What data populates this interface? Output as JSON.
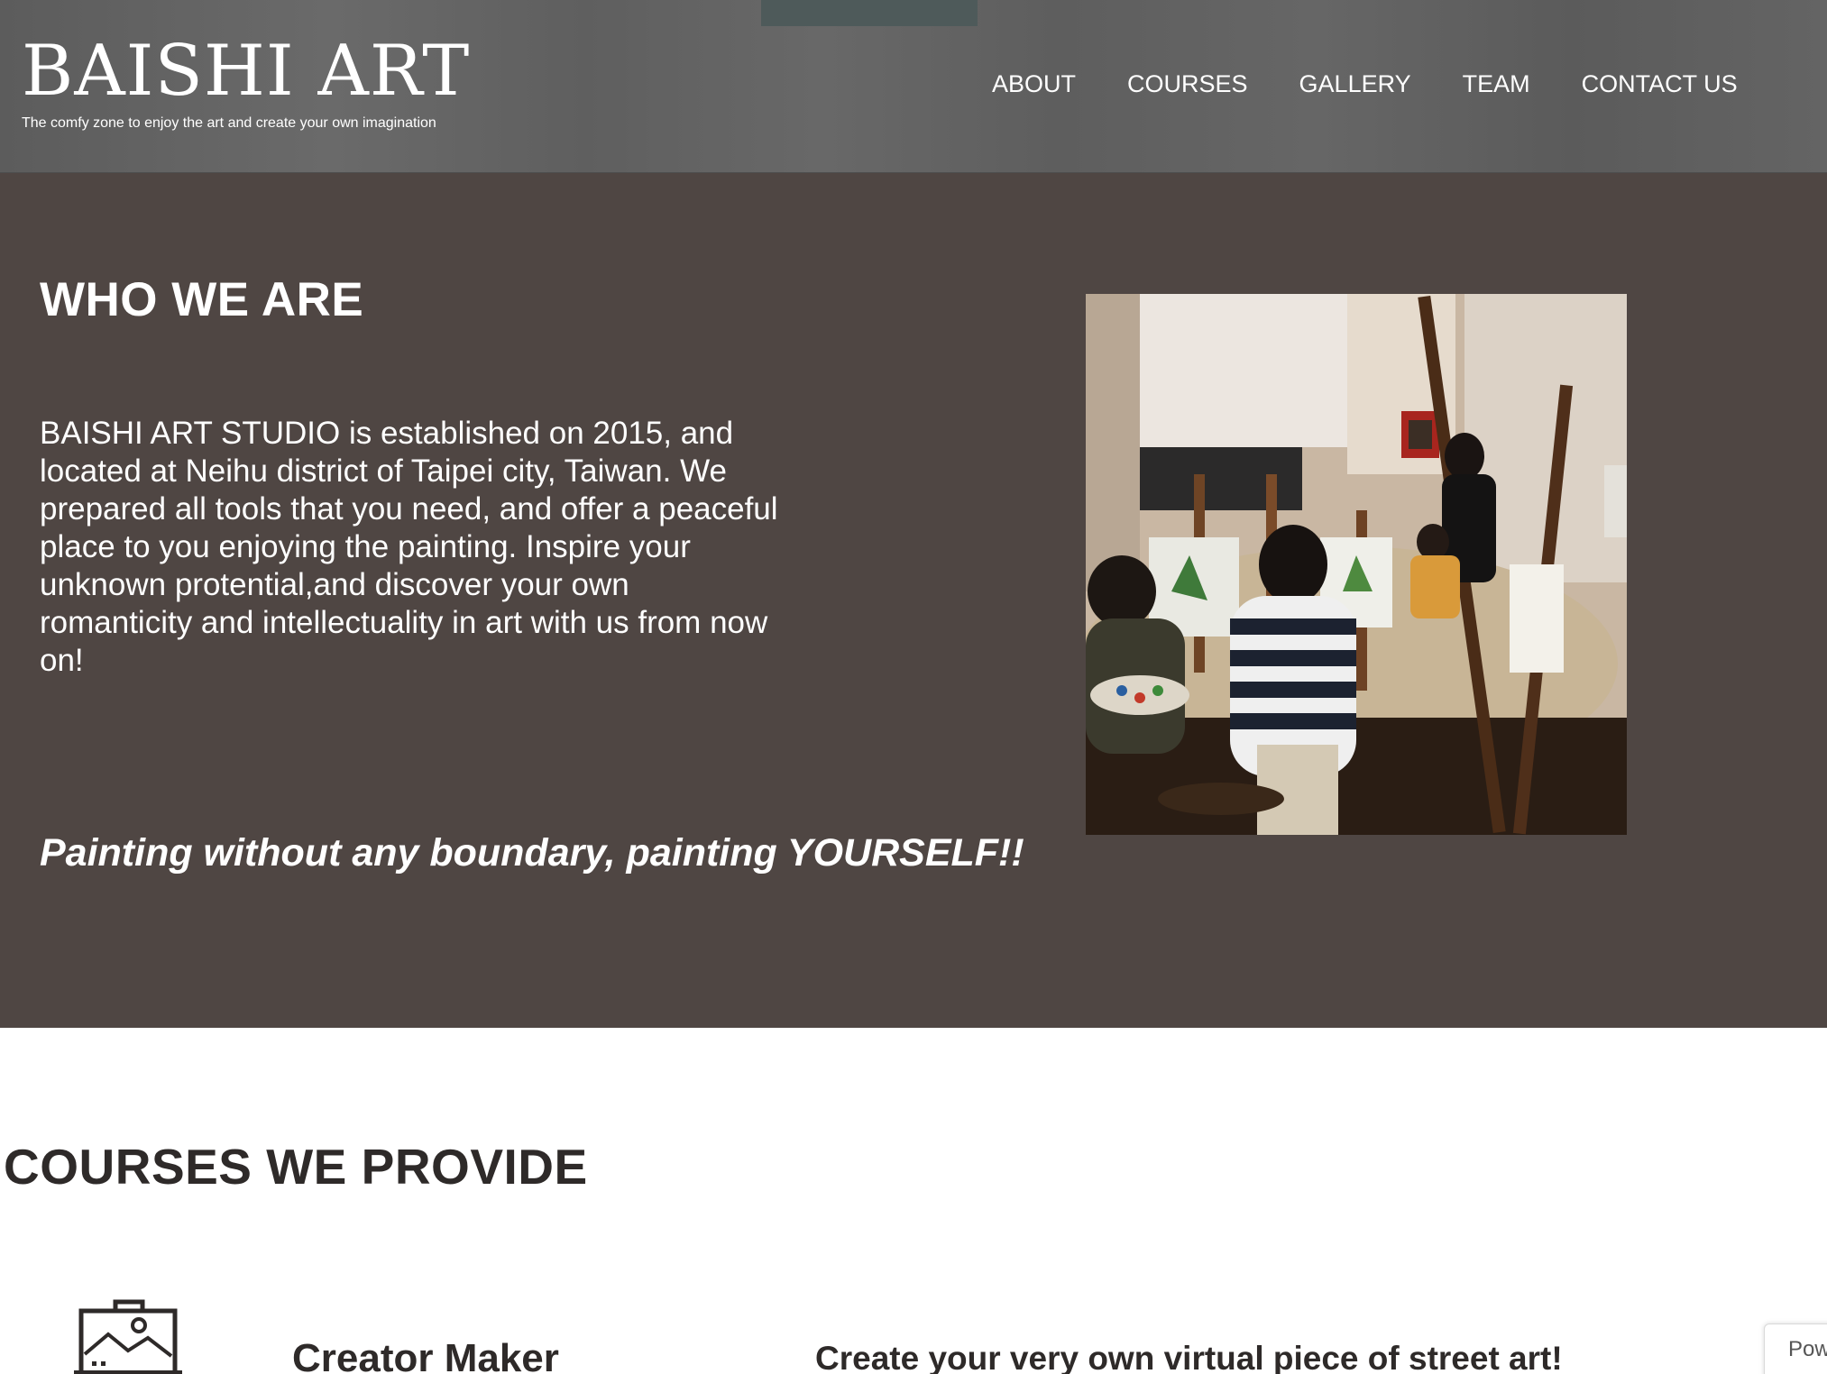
{
  "header": {
    "brand_title": "BAISHI ART",
    "tagline": "The comfy zone to enjoy the art and create your own imagination",
    "nav": [
      {
        "label": "ABOUT"
      },
      {
        "label": "COURSES"
      },
      {
        "label": "GALLERY"
      },
      {
        "label": "TEAM"
      },
      {
        "label": "CONTACT US"
      }
    ]
  },
  "about": {
    "heading": "WHO WE ARE",
    "body": "BAISHI ART STUDIO is established on 2015, and located at Neihu district of Taipei city, Taiwan. We prepared all tools that you need, and offer a peaceful place to you enjoying the painting. Inspire your unknown protential,and discover your own romanticity and intellectuality in art with us from now on!",
    "slogan": "Painting without any boundary, painting YOURSELF!!",
    "photo_icon": "studio-photo"
  },
  "courses": {
    "heading": "COURSES WE PROVIDE",
    "items": [
      {
        "icon": "easel-picture-icon",
        "title": "Creator Maker",
        "description": "Create your very own virtual piece of street art!"
      }
    ]
  },
  "badge": {
    "label": "Pow"
  },
  "colors": {
    "header_bg": "#636363",
    "about_bg": "#4f4643",
    "text_dark": "#2e2a29",
    "white": "#ffffff"
  }
}
